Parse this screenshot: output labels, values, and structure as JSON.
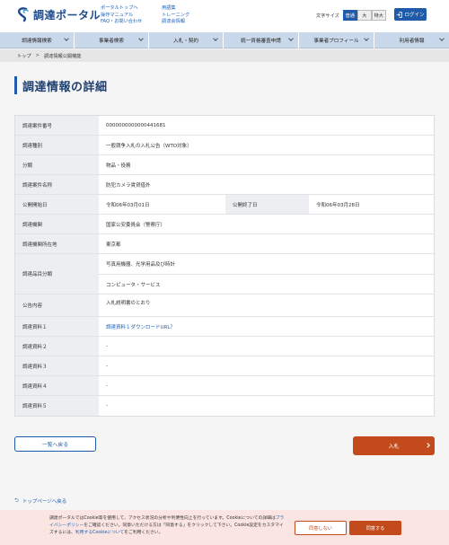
{
  "header": {
    "logo_text": "調達ポータル",
    "links_col1": [
      "ポータルトップへ",
      "操作マニュアル",
      "FAQ・お問い合わせ"
    ],
    "links_col2": [
      "用語集",
      "トレーニング",
      "調達会情報"
    ],
    "font_size_label": "文字サイズ",
    "font_sizes": [
      "普通",
      "大",
      "特大"
    ],
    "login_label": "ログイン",
    "accent_color": "#1f5ba8"
  },
  "nav": {
    "items": [
      "調達情報検索",
      "事業者検索",
      "入札・契約",
      "統一資格審査申請",
      "事業者プロフィール",
      "利用者情報"
    ]
  },
  "breadcrumb": {
    "home": "トップ",
    "sep": ">",
    "current": "調達情報公開機能"
  },
  "page_title": "調達情報の詳細",
  "details": {
    "case_number_label": "調達案件番号",
    "case_number": "0000000000000441681",
    "type_label": "調達種別",
    "type": "一般競争入札の入札公告（WTO対象）",
    "category_label": "分類",
    "category": "物品・役務",
    "case_name_label": "調達案件名称",
    "case_name": "防犯カメラ賃貸借外",
    "start_label": "公開開始日",
    "start_date": "令和06年03月01日",
    "end_label": "公開終了日",
    "end_date": "令和06年03月28日",
    "org_label": "調達機関",
    "org": "国家公安委員会（警察庁）",
    "location_label": "調達機関所在地",
    "location": "東京都",
    "item_class_label": "調達品目分類",
    "item_classes": [
      "写真用機器、光学用品及び時計",
      "コンピュータ・サービス"
    ],
    "notice_label": "公告内容",
    "notice": "入札説明書のとおり",
    "docs": [
      {
        "label": "調達資料１",
        "value": "調達資料１ダウンロードURL？"
      },
      {
        "label": "調達資料２",
        "value": "-"
      },
      {
        "label": "調達資料３",
        "value": "-"
      },
      {
        "label": "調達資料４",
        "value": "-"
      },
      {
        "label": "調達資料５",
        "value": "-"
      }
    ]
  },
  "actions": {
    "back_label": "一覧へ戻る",
    "bid_label": "入札"
  },
  "to_top_label": "トップページへ戻る",
  "cookie": {
    "text": "調達ポータルではCookie等を使用して、アクセス状況の分析や利便性向上を行っています。Cookieについての詳細は",
    "privacy_link": "プライバシーポリシー",
    "text2": "をご確認ください。同意いただける方は「同意する」をクリックして下さい。Cookie設定をカスタマイズするには、",
    "settings_link": "利用するCookieについて",
    "text3": "をご利用ください。",
    "deny_label": "同意しない",
    "accept_label": "同意する"
  }
}
